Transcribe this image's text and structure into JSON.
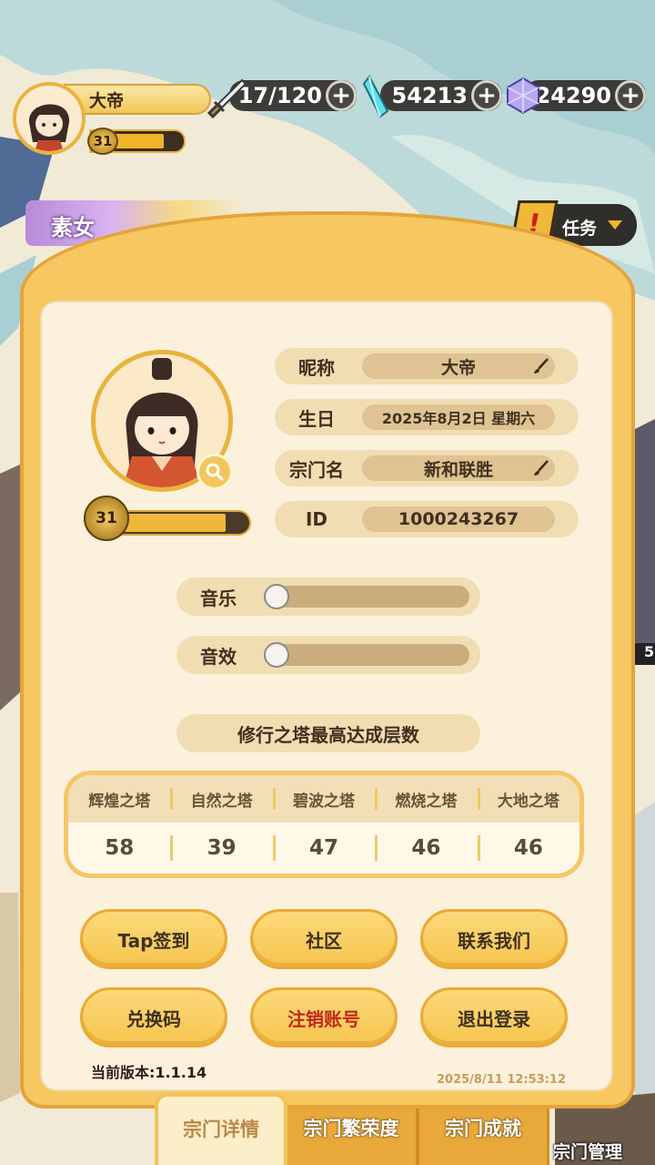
{
  "player": {
    "name": "大帝",
    "level": "31",
    "level_progress": 0.8
  },
  "resources": {
    "stamina": "17/120",
    "crystal": "54213",
    "gem": "24290"
  },
  "character_tag": "素女",
  "quest": {
    "label": "任务",
    "alert": "!"
  },
  "profile": {
    "nickname_label": "昵称",
    "nickname_value": "大帝",
    "birthday_label": "生日",
    "birthday_value": "2025年8月2日 星期六",
    "sect_label": "宗门名",
    "sect_value": "新和联胜",
    "id_label": "ID",
    "id_value": "1000243267",
    "level": "31",
    "level_progress": 0.84
  },
  "settings": {
    "music_label": "音乐",
    "music_level": 0,
    "sfx_label": "音效",
    "sfx_level": 0
  },
  "towers": {
    "title": "修行之塔最高达成层数",
    "names": [
      "辉煌之塔",
      "自然之塔",
      "碧波之塔",
      "燃烧之塔",
      "大地之塔"
    ],
    "values": [
      "58",
      "39",
      "47",
      "46",
      "46"
    ]
  },
  "buttons": {
    "tap_signin": "Tap签到",
    "community": "社区",
    "contact": "联系我们",
    "redeem": "兑换码",
    "cancel_account": "注销账号",
    "logout": "退出登录"
  },
  "footer": {
    "version": "当前版本:1.1.14",
    "timestamp": "2025/8/11 12:53:12"
  },
  "tabs": {
    "details": "宗门详情",
    "prosperity": "宗门繁荣度",
    "achievements": "宗门成就",
    "management": "宗门管理"
  },
  "side_badge": "5",
  "colors": {
    "panel": "#f7c862",
    "panel_inner": "#fbf1dc",
    "danger": "#c0281e"
  }
}
